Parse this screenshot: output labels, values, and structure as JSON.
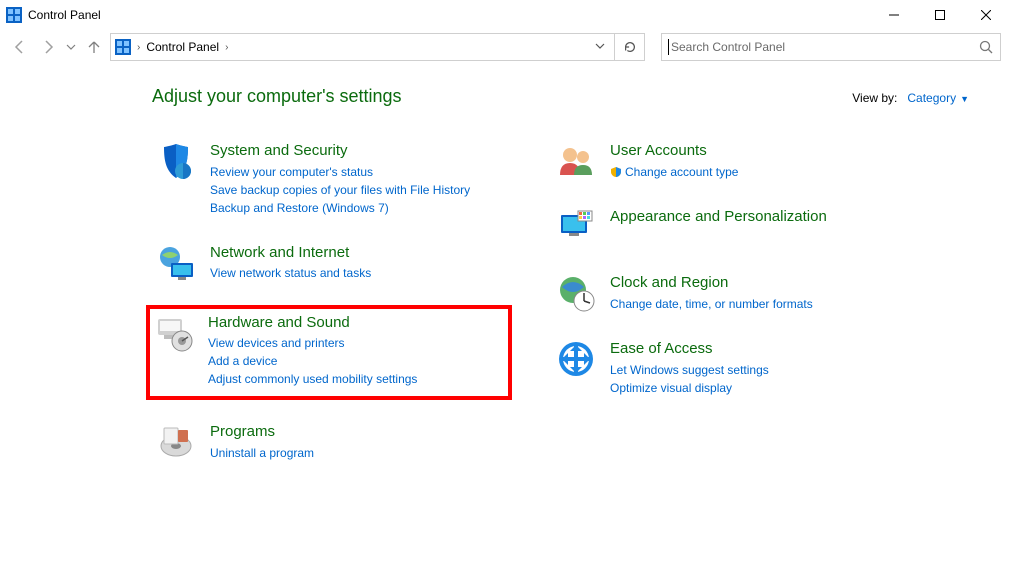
{
  "window": {
    "title": "Control Panel"
  },
  "breadcrumb": {
    "root": "Control Panel"
  },
  "search": {
    "placeholder": "Search Control Panel"
  },
  "heading": "Adjust your computer's settings",
  "viewby": {
    "label": "View by:",
    "value": "Category"
  },
  "left": [
    {
      "title": "System and Security",
      "links": [
        "Review your computer's status",
        "Save backup copies of your files with File History",
        "Backup and Restore (Windows 7)"
      ]
    },
    {
      "title": "Network and Internet",
      "links": [
        "View network status and tasks"
      ]
    },
    {
      "title": "Hardware and Sound",
      "links": [
        "View devices and printers",
        "Add a device",
        "Adjust commonly used mobility settings"
      ]
    },
    {
      "title": "Programs",
      "links": [
        "Uninstall a program"
      ]
    }
  ],
  "right": [
    {
      "title": "User Accounts",
      "links": [
        "Change account type"
      ]
    },
    {
      "title": "Appearance and Personalization",
      "links": []
    },
    {
      "title": "Clock and Region",
      "links": [
        "Change date, time, or number formats"
      ]
    },
    {
      "title": "Ease of Access",
      "links": [
        "Let Windows suggest settings",
        "Optimize visual display"
      ]
    }
  ]
}
